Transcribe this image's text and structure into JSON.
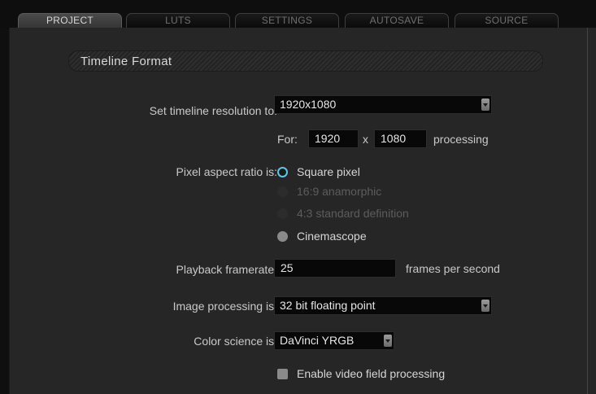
{
  "tabs": [
    {
      "label": "PROJECT",
      "active": true
    },
    {
      "label": "LUTS",
      "active": false
    },
    {
      "label": "SETTINGS",
      "active": false
    },
    {
      "label": "AUTOSAVE",
      "active": false
    },
    {
      "label": "SOURCE",
      "active": false
    }
  ],
  "section": {
    "title": "Timeline Format"
  },
  "resolution": {
    "label": "Set timeline resolution to:",
    "value": "1920x1080",
    "for_label": "For:",
    "width": "1920",
    "x_label": "x",
    "height": "1080",
    "processing_label": "processing"
  },
  "aspect": {
    "label": "Pixel aspect ratio is:",
    "options": [
      {
        "label": "Square pixel",
        "state": "selected"
      },
      {
        "label": "16:9 anamorphic",
        "state": "disabled"
      },
      {
        "label": "4:3 standard definition",
        "state": "disabled"
      },
      {
        "label": "Cinemascope",
        "state": "normal"
      }
    ]
  },
  "framerate": {
    "label": "Playback framerate:",
    "value": "25",
    "unit": "frames per second"
  },
  "image_processing": {
    "label": "Image processing is:",
    "value": "32 bit floating point"
  },
  "color_science": {
    "label": "Color science is:",
    "value": "DaVinci YRGB"
  },
  "video_field": {
    "label": "Enable video field processing",
    "checked": false
  },
  "colors": {
    "selected_radio": "#5fc7e6",
    "background": "#262626"
  }
}
